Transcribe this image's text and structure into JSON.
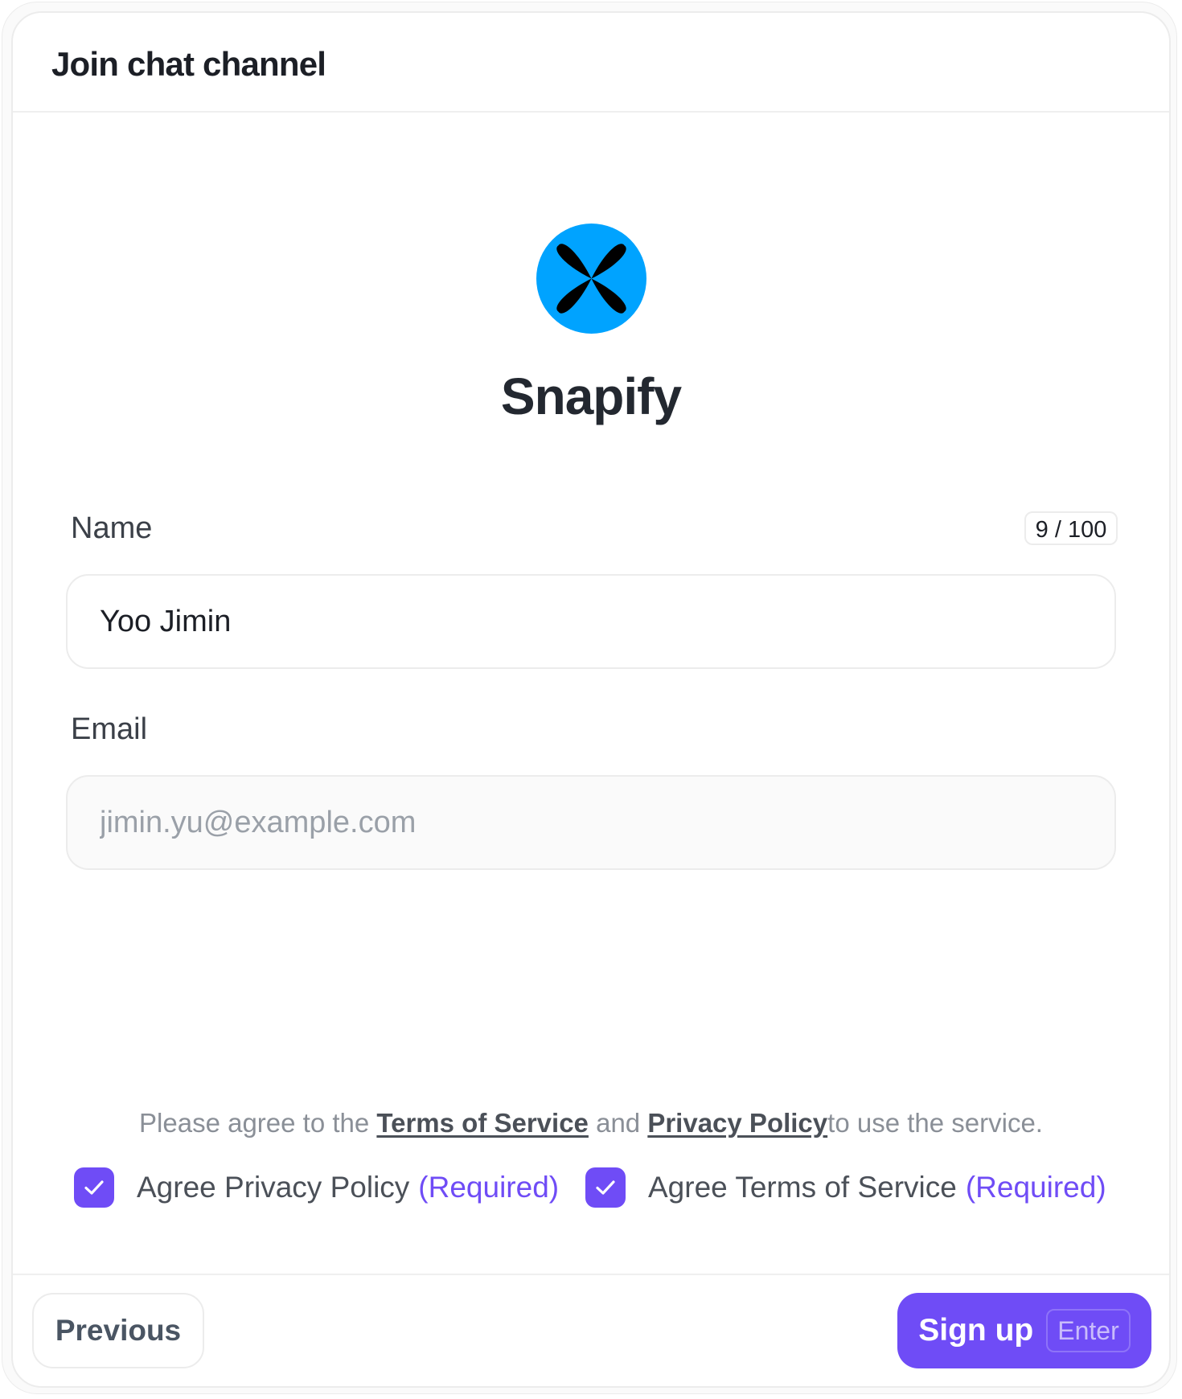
{
  "dialog": {
    "title": "Join chat channel"
  },
  "app": {
    "name": "Snapify",
    "logo_icon": "snapify-logo-icon",
    "logo_color": "#00a3ff"
  },
  "form": {
    "name": {
      "label": "Name",
      "value": "Yoo Jimin",
      "counter": "9 / 100"
    },
    "email": {
      "label": "Email",
      "value": "",
      "placeholder": "jimin.yu@example.com"
    }
  },
  "agreement": {
    "text_prefix": "Please agree to the ",
    "terms_link": "Terms of Service",
    "text_and": " and ",
    "privacy_link": "Privacy Policy",
    "text_suffix": "to use the service.",
    "checkboxes": [
      {
        "label": "Agree Privacy Policy",
        "required_label": "(Required)",
        "checked": true,
        "icon": "checkmark-icon"
      },
      {
        "label": "Agree Terms of Service",
        "required_label": "(Required)",
        "checked": true,
        "icon": "checkmark-icon"
      }
    ]
  },
  "footer": {
    "previous_label": "Previous",
    "signup_label": "Sign up",
    "signup_shortcut": "Enter"
  },
  "colors": {
    "accent": "#6f4cf6",
    "text_primary": "#1c1f26",
    "border": "#ececec"
  }
}
